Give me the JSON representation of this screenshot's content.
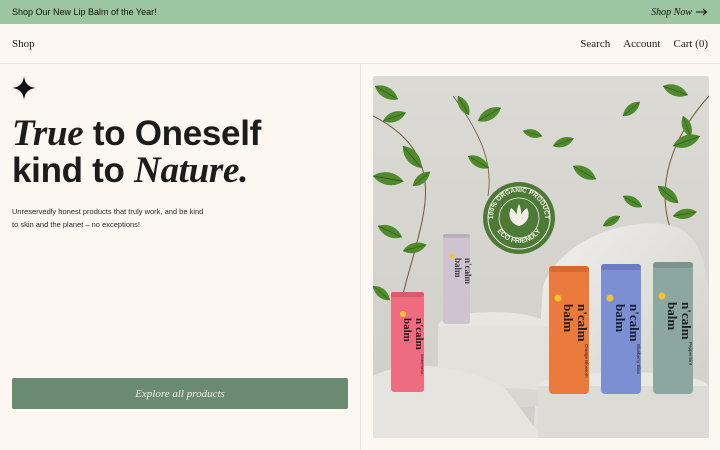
{
  "banner": {
    "text": "Shop Our New Lip Balm of the Year!",
    "link": "Shop Now"
  },
  "nav": {
    "shop": "Shop",
    "search": "Search",
    "account": "Account",
    "cart": "Cart (0)"
  },
  "hero": {
    "line1_italic": "True",
    "line1_rest": " to Oneself",
    "line2_start": "kind to ",
    "line2_italic": "Nature",
    "line2_end": ".",
    "desc_line1": "Unreservedly honest products that truly work, and be kind",
    "desc_line2": "to skin and the planet – no exceptions!",
    "cta": "Explore all products"
  },
  "image": {
    "badge_top": "100% ORGANIC PRODUCT",
    "badge_bottom": "ECO FRIENDLY",
    "brand_line1": "balm",
    "brand_line2": "n'calm",
    "flavors": {
      "pink": "Watermelon",
      "orange": "Orange Blossom",
      "blue": "Blueberry Bliss",
      "teal": "Peppermint"
    }
  },
  "colors": {
    "banner": "#9cc5a1",
    "cta": "#6a8a72",
    "background": "#fcf7f1",
    "tube_pink": "#ee6b80",
    "tube_lilac": "#cdc4d0",
    "tube_orange": "#eb7a3d",
    "tube_blue": "#7c8fd3",
    "tube_teal": "#8ca7a0"
  }
}
